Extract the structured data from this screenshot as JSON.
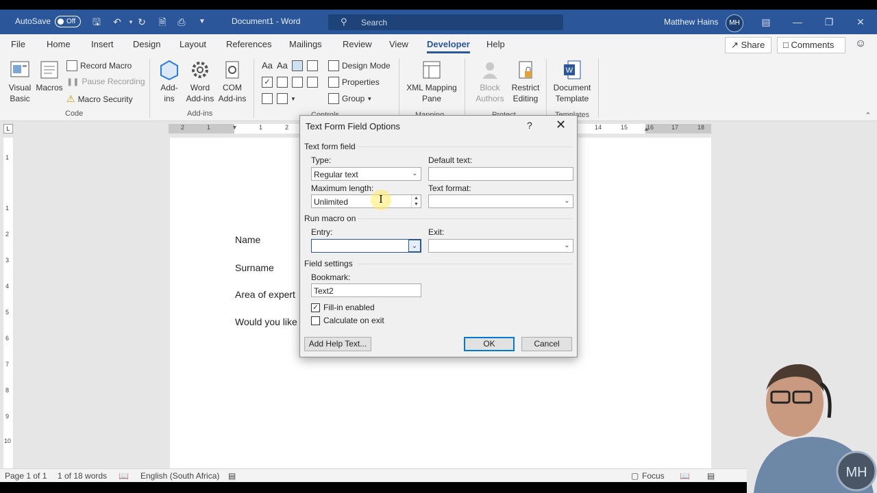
{
  "titlebar": {
    "autosave": "AutoSave",
    "autosave_state": "Off",
    "doc_title": "Document1  -  Word",
    "search_placeholder": "Search",
    "user_name": "Matthew Hains",
    "user_initials": "MH"
  },
  "tabs": [
    "File",
    "Home",
    "Insert",
    "Design",
    "Layout",
    "References",
    "Mailings",
    "Review",
    "View",
    "Developer",
    "Help"
  ],
  "active_tab": "Developer",
  "top_buttons": {
    "share": "Share",
    "comments": "Comments"
  },
  "ribbon": {
    "code": {
      "visual_basic": "Visual Basic",
      "macros": "Macros",
      "record_macro": "Record Macro",
      "pause_recording": "Pause Recording",
      "macro_security": "Macro Security",
      "group": "Code"
    },
    "addins": {
      "add_ins": "Add-ins",
      "word_addins": "Word Add-ins",
      "com_addins": "COM Add-ins",
      "group": "Add-ins"
    },
    "controls": {
      "design_mode": "Design Mode",
      "properties": "Properties",
      "group_btn": "Group",
      "group": "Controls"
    },
    "mapping": {
      "xml_pane": "XML Mapping Pane",
      "group": "Mapping"
    },
    "protect": {
      "block_authors": "Block Authors",
      "restrict_editing": "Restrict Editing",
      "group": "Protect"
    },
    "templates": {
      "document_template": "Document Template",
      "group": "Templates"
    }
  },
  "ruler_numbers": [
    "2",
    "1",
    "1",
    "2",
    "14",
    "15",
    "16",
    "17",
    "18"
  ],
  "vruler_numbers": [
    "1",
    "1",
    "2",
    "3",
    "4",
    "5",
    "6",
    "7",
    "8",
    "9",
    "10"
  ],
  "document": {
    "lines": [
      "Name",
      "Surname",
      "Area of expert",
      "Would you like"
    ]
  },
  "dialog": {
    "title": "Text Form Field Options",
    "help": "?",
    "section_field": "Text form field",
    "type_label": "Type:",
    "type_value": "Regular text",
    "default_text_label": "Default text:",
    "default_text_value": "",
    "max_length_label": "Maximum length:",
    "max_length_value": "Unlimited",
    "text_format_label": "Text format:",
    "text_format_value": "",
    "section_macro": "Run macro on",
    "entry_label": "Entry:",
    "entry_value": "",
    "exit_label": "Exit:",
    "exit_value": "",
    "section_settings": "Field settings",
    "bookmark_label": "Bookmark:",
    "bookmark_value": "Text2",
    "fill_in_label": "Fill-in enabled",
    "fill_in_checked": true,
    "calc_label": "Calculate on exit",
    "calc_checked": false,
    "add_help_text": "Add Help Text...",
    "ok": "OK",
    "cancel": "Cancel"
  },
  "status": {
    "page": "Page 1 of 1",
    "words": "1 of 18 words",
    "language": "English (South Africa)",
    "focus": "Focus"
  },
  "colors": {
    "word_blue": "#2b579a",
    "ribbon_bg": "#f3f3f3",
    "canvas": "#e6e6e6"
  }
}
